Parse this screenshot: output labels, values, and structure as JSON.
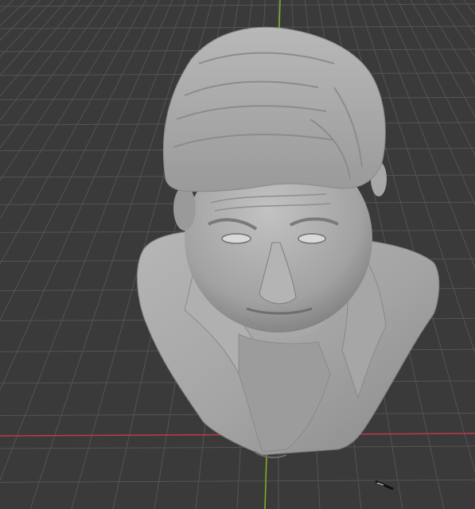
{
  "viewport": {
    "name": "3D Viewport",
    "background_color": "#3a3a3a",
    "grid_color": "#545454",
    "grid_minor_color": "#484848",
    "x_axis_color": "#c0394a",
    "y_axis_color": "#7fb22a"
  },
  "model": {
    "name": "sculpted-bust",
    "material_color": "#a3a3a3",
    "shade_light": "#c4c4c4",
    "shade_dark": "#6e6e6e"
  },
  "cursor": {
    "icon": "3d-cursor-icon"
  }
}
